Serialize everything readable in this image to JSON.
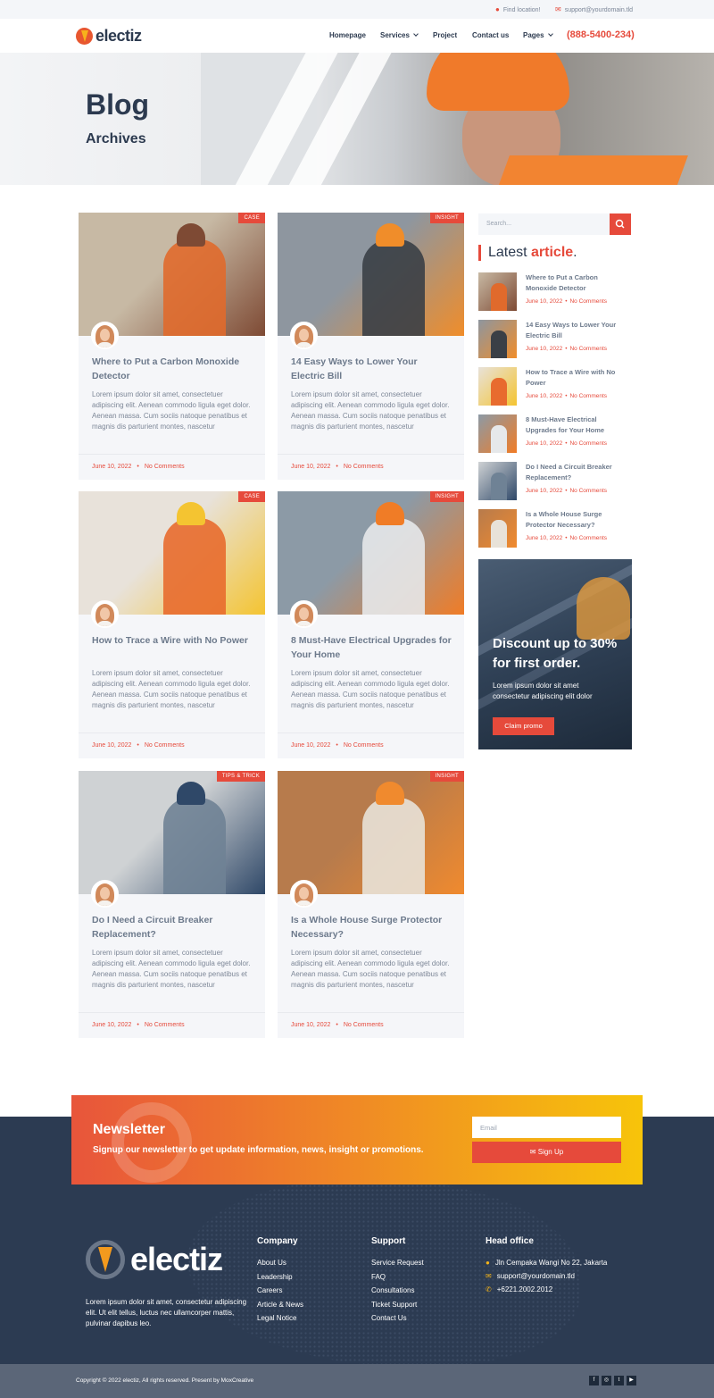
{
  "topbar": {
    "location": "Find location!",
    "email": "support@yourdomain.tld"
  },
  "nav": {
    "logo": "electiz",
    "items": [
      "Homepage",
      "Services",
      "Project",
      "Contact us",
      "Pages"
    ],
    "phone": "(888-5400-234)"
  },
  "hero": {
    "title": "Blog",
    "subtitle": "Archives"
  },
  "posts": [
    {
      "badge": "CASE",
      "title": "Where to Put a Carbon Monoxide Detector",
      "excerpt": "Lorem ipsum dolor sit amet, consectetuer adipiscing elit. Aenean commodo ligula eget dolor. Aenean massa. Cum sociis natoque penatibus et magnis dis parturient montes, nascetur",
      "date": "June 10, 2022",
      "comments": "No Comments"
    },
    {
      "badge": "INSIGHT",
      "title": "14 Easy Ways to Lower Your Electric Bill",
      "excerpt": "Lorem ipsum dolor sit amet, consectetuer adipiscing elit. Aenean commodo ligula eget dolor. Aenean massa. Cum sociis natoque penatibus et magnis dis parturient montes, nascetur",
      "date": "June 10, 2022",
      "comments": "No Comments"
    },
    {
      "badge": "CASE",
      "title": "How to Trace a Wire with No Power",
      "excerpt": "Lorem ipsum dolor sit amet, consectetuer adipiscing elit. Aenean commodo ligula eget dolor. Aenean massa. Cum sociis natoque penatibus et magnis dis parturient montes, nascetur",
      "date": "June 10, 2022",
      "comments": "No Comments"
    },
    {
      "badge": "INSIGHT",
      "title": "8 Must-Have Electrical Upgrades for Your Home",
      "excerpt": "Lorem ipsum dolor sit amet, consectetuer adipiscing elit. Aenean commodo ligula eget dolor. Aenean massa. Cum sociis natoque penatibus et magnis dis parturient montes, nascetur",
      "date": "June 10, 2022",
      "comments": "No Comments"
    },
    {
      "badge": "TIPS & TRICK",
      "title": "Do I Need a Circuit Breaker Replacement?",
      "excerpt": "Lorem ipsum dolor sit amet, consectetuer adipiscing elit. Aenean commodo ligula eget dolor. Aenean massa. Cum sociis natoque penatibus et magnis dis parturient montes, nascetur",
      "date": "June 10, 2022",
      "comments": "No Comments"
    },
    {
      "badge": "INSIGHT",
      "title": "Is a Whole House Surge Protector Necessary?",
      "excerpt": "Lorem ipsum dolor sit amet, consectetuer adipiscing elit. Aenean commodo ligula eget dolor. Aenean massa. Cum sociis natoque penatibus et magnis dis parturient montes, nascetur",
      "date": "June 10, 2022",
      "comments": "No Comments"
    }
  ],
  "sidebar": {
    "search_placeholder": "Search...",
    "latest_prefix": "Latest ",
    "latest_accent": "article",
    "latest_suffix": ".",
    "latest": [
      {
        "title": "Where to Put a Carbon Monoxide Detector",
        "date": "June 10, 2022",
        "comments": "No Comments"
      },
      {
        "title": "14 Easy Ways to Lower Your Electric Bill",
        "date": "June 10, 2022",
        "comments": "No Comments"
      },
      {
        "title": "How to Trace a Wire with No Power",
        "date": "June 10, 2022",
        "comments": "No Comments"
      },
      {
        "title": "8 Must-Have Electrical Upgrades for Your Home",
        "date": "June 10, 2022",
        "comments": "No Comments"
      },
      {
        "title": "Do I Need a Circuit Breaker Replacement?",
        "date": "June 10, 2022",
        "comments": "No Comments"
      },
      {
        "title": "Is a Whole House Surge Protector Necessary?",
        "date": "June 10, 2022",
        "comments": "No Comments"
      }
    ],
    "promo": {
      "title": "Discount up to 30% for first order.",
      "text": "Lorem ipsum dolor sit amet consectetur adipiscing elit dolor",
      "button": "Claim promo"
    }
  },
  "newsletter": {
    "title": "Newsletter",
    "text": "Signup our newsletter to get update information, news, insight or promotions.",
    "placeholder": "Email",
    "button": "Sign Up"
  },
  "footer": {
    "logo": "electiz",
    "desc": "Lorem ipsum dolor sit amet, consectetur adipiscing elit. Ut elit tellus, luctus nec ullamcorper mattis, pulvinar dapibus leo.",
    "company_title": "Company",
    "company": [
      "About Us",
      "Leadership",
      "Careers",
      "Article & News",
      "Legal Notice"
    ],
    "support_title": "Support",
    "support": [
      "Service Request",
      "FAQ",
      "Consultations",
      "Ticket Support",
      "Contact Us"
    ],
    "office_title": "Head office",
    "address": "Jln Cempaka Wangi No 22, Jakarta",
    "email": "support@yourdomain.tld",
    "phone": "+6221.2002.2012",
    "copyright": "Copyright © 2022 electiz, All rights reserved. Present by MoxCreative",
    "social": [
      "f",
      "◎",
      "t",
      "▶"
    ]
  },
  "colors": {
    "accent": "#e64a3b",
    "dark": "#2c3b52",
    "text": "#2c3a4f"
  },
  "icons": {
    "location": "map-pin-icon",
    "email": "envelope-icon",
    "search": "search-icon",
    "chevron": "chevron-down-icon"
  }
}
